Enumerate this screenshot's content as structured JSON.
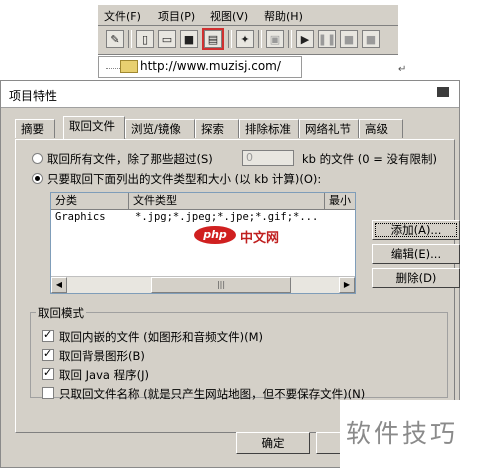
{
  "app": {
    "menu": [
      "文件(F)",
      "项目(P)",
      "视图(V)",
      "帮助(H)"
    ],
    "toolbar_icons": [
      "edit-icon",
      "new-icon",
      "open-icon",
      "save-icon",
      "properties-icon",
      "wizard-icon",
      "screenshot-icon",
      "play-icon",
      "pause-icon",
      "stop-icon"
    ],
    "tree_url": "http://www.muzisj.com/",
    "return_mark": "↵"
  },
  "dialog": {
    "title": "项目特性",
    "tabs": [
      "摘要",
      "取回文件",
      "浏览/镜像",
      "探索",
      "排除标准",
      "网络礼节",
      "高级"
    ],
    "active_tab": "取回文件",
    "option_all": "取回所有文件，除了那些超过(S)",
    "kb_value": "0",
    "kb_suffix": "kb 的文件  (0 = 没有限制)",
    "option_types": "只要取回下面列出的文件类型和大小 (以 kb 计算)(O):",
    "list": {
      "columns": [
        "分类",
        "文件类型",
        "最小"
      ],
      "rows": [
        {
          "category": "Graphics",
          "types": "*.jpg;*.jpeg;*.jpe;*.gif;*..."
        }
      ]
    },
    "buttons": {
      "add": "添加(A)...",
      "edit": "编辑(E)...",
      "delete": "删除(D)",
      "ok": "确定"
    },
    "group": {
      "label": "取回模式",
      "options": [
        {
          "label": "取回内嵌的文件 (如图形和音频文件)(M)",
          "checked": true
        },
        {
          "label": "取回背景图形(B)",
          "checked": true
        },
        {
          "label": "取回 Java 程序(J)",
          "checked": true
        },
        {
          "label": "只取回文件名称 (就是只产生网站地图，但不要保存文件)(N)",
          "checked": false
        }
      ]
    }
  },
  "watermarks": {
    "php_logo": "php",
    "php_site": "中文网",
    "bottom": "软件技巧"
  }
}
